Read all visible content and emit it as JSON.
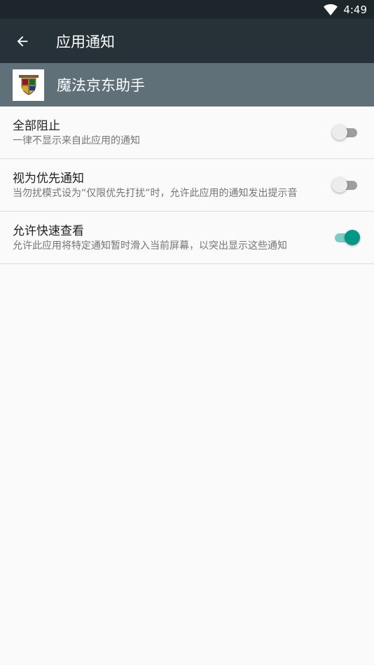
{
  "status_bar": {
    "time": "4:49",
    "wifi_icon": "wifi-icon"
  },
  "app_bar": {
    "back_icon": "arrow-back-icon",
    "title": "应用通知"
  },
  "app_header": {
    "icon": "hogwarts-crest-icon",
    "name": "魔法京东助手"
  },
  "settings": [
    {
      "title": "全部阻止",
      "summary": "一律不显示来自此应用的通知",
      "enabled": false
    },
    {
      "title": "视为优先通知",
      "summary": "当勿扰模式设为“仅限优先打扰”时，允许此应用的通知发出提示音",
      "enabled": false
    },
    {
      "title": "允许快速查看",
      "summary": "允许此应用将特定通知暂时滑入当前屏幕，以突出显示这些通知",
      "enabled": true
    }
  ],
  "colors": {
    "status_bar": "#1c262b",
    "app_bar": "#263238",
    "app_header": "#5f7079",
    "accent": "#009688"
  }
}
